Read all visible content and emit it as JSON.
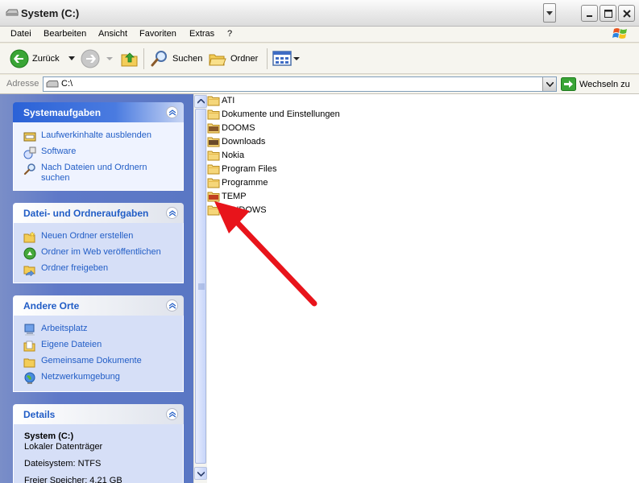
{
  "window": {
    "title": "System (C:)"
  },
  "menu": [
    {
      "label": "Datei"
    },
    {
      "label": "Bearbeiten"
    },
    {
      "label": "Ansicht"
    },
    {
      "label": "Favoriten"
    },
    {
      "label": "Extras"
    },
    {
      "label": "?"
    }
  ],
  "toolbar": {
    "back_label": "Zurück",
    "search_label": "Suchen",
    "folders_label": "Ordner"
  },
  "address": {
    "label": "Adresse",
    "value": "C:\\",
    "go_label": "Wechseln zu"
  },
  "panels": {
    "system": {
      "title": "Systemaufgaben",
      "items": [
        {
          "label": "Laufwerkinhalte ausblenden",
          "icon": "hide-drive-icon"
        },
        {
          "label": "Software",
          "icon": "software-icon"
        },
        {
          "label": "Nach Dateien und Ordnern suchen",
          "icon": "search-icon"
        }
      ]
    },
    "file": {
      "title": "Datei- und Ordneraufgaben",
      "items": [
        {
          "label": "Neuen Ordner erstellen",
          "icon": "new-folder-icon"
        },
        {
          "label": "Ordner im Web veröffentlichen",
          "icon": "publish-web-icon"
        },
        {
          "label": "Ordner freigeben",
          "icon": "share-folder-icon"
        }
      ]
    },
    "places": {
      "title": "Andere Orte",
      "items": [
        {
          "label": "Arbeitsplatz",
          "icon": "my-computer-icon"
        },
        {
          "label": "Eigene Dateien",
          "icon": "my-documents-icon"
        },
        {
          "label": "Gemeinsame Dokumente",
          "icon": "shared-documents-icon"
        },
        {
          "label": "Netzwerkumgebung",
          "icon": "network-icon"
        }
      ]
    },
    "details": {
      "title": "Details",
      "name": "System (C:)",
      "type": "Lokaler Datenträger",
      "fs": "Dateisystem: NTFS",
      "free": "Freier Speicher: 4,21 GB"
    }
  },
  "files": [
    {
      "name": "ATI"
    },
    {
      "name": "Dokumente und Einstellungen"
    },
    {
      "name": "DOOMS"
    },
    {
      "name": "Downloads"
    },
    {
      "name": "Nokia"
    },
    {
      "name": "Program Files"
    },
    {
      "name": "Programme"
    },
    {
      "name": "TEMP"
    },
    {
      "name": "WINDOWS"
    }
  ],
  "colors": {
    "link": "#215dc6",
    "arrow": "#e8141b",
    "folder": "#f5d67a"
  }
}
